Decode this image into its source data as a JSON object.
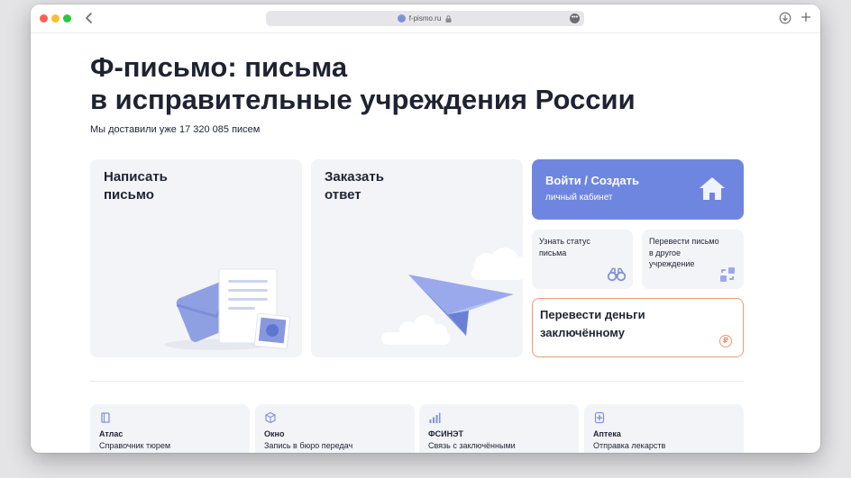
{
  "browser": {
    "url": "f-pismo.ru",
    "more_label": "•••"
  },
  "hero": {
    "title_line1": "Ф-письмо: письма",
    "title_line2": "в исправительные учреждения России",
    "subtitle": "Мы доставили уже 17 320 085 писем"
  },
  "cards": {
    "write": {
      "line1": "Написать",
      "line2": "письмо"
    },
    "order": {
      "line1": "Заказать",
      "line2": "ответ"
    },
    "login": {
      "title": "Войти / Создать",
      "subtitle": "личный кабинет",
      "icon": "home-icon"
    },
    "status": {
      "line1": "Узнать статус",
      "line2": "письма",
      "icon": "binoculars-icon"
    },
    "transfer": {
      "line1": "Перевести письмо",
      "line2": "в другое",
      "line3": "учреждение",
      "icon": "swap-icon"
    },
    "money": {
      "line1": "Перевести деньги",
      "line2": "заключённому",
      "icon": "ruble-icon",
      "icon_glyph": "₽"
    }
  },
  "services": [
    {
      "name": "Атлас",
      "desc": "Справочник тюрем",
      "icon": "book-icon"
    },
    {
      "name": "Окно",
      "desc": "Запись в бюро передач",
      "icon": "package-icon"
    },
    {
      "name": "ФСИНЭТ",
      "desc": "Связь с заключёнными",
      "icon": "signal-icon"
    },
    {
      "name": "Аптека",
      "desc": "Отправка лекарств",
      "icon": "pharmacy-icon"
    }
  ],
  "colors": {
    "accent_blue": "#6f86e0",
    "money_border": "#ef9a73",
    "card_bg": "#f3f4f7",
    "text_dark": "#1e2331"
  }
}
